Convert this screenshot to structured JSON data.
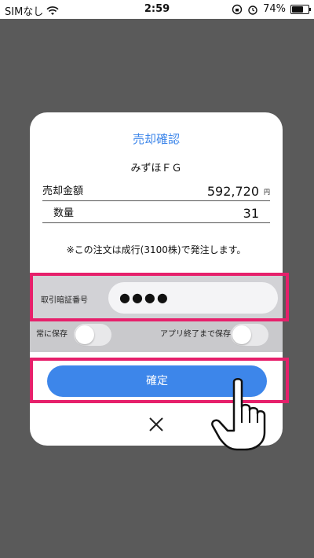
{
  "status_bar": {
    "carrier": "SIMなし",
    "time": "2:59",
    "battery": "74%",
    "battery_level": 0.74
  },
  "dialog": {
    "title": "売却確認",
    "stock_name": "みずほＦＧ",
    "rows": [
      {
        "label": "売却金額",
        "value": "592,720",
        "unit": "円"
      },
      {
        "label": "数量",
        "value": "31",
        "unit": ""
      }
    ],
    "notice": "※この注文は成行(3100株)で発注します。",
    "pin": {
      "label": "取引暗証番号",
      "value": "●●●●"
    },
    "options": {
      "always_save": "常に保存",
      "save_until_exit": "アプリ終了まで保存"
    },
    "confirm_label": "確定"
  },
  "colors": {
    "accent": "#3d86ea",
    "highlight": "#e6206b",
    "backdrop": "#5a5a5a"
  },
  "icons": [
    "wifi-icon",
    "lock-rotation-icon",
    "alarm-icon",
    "battery-icon",
    "close-icon",
    "pointing-hand-icon"
  ]
}
